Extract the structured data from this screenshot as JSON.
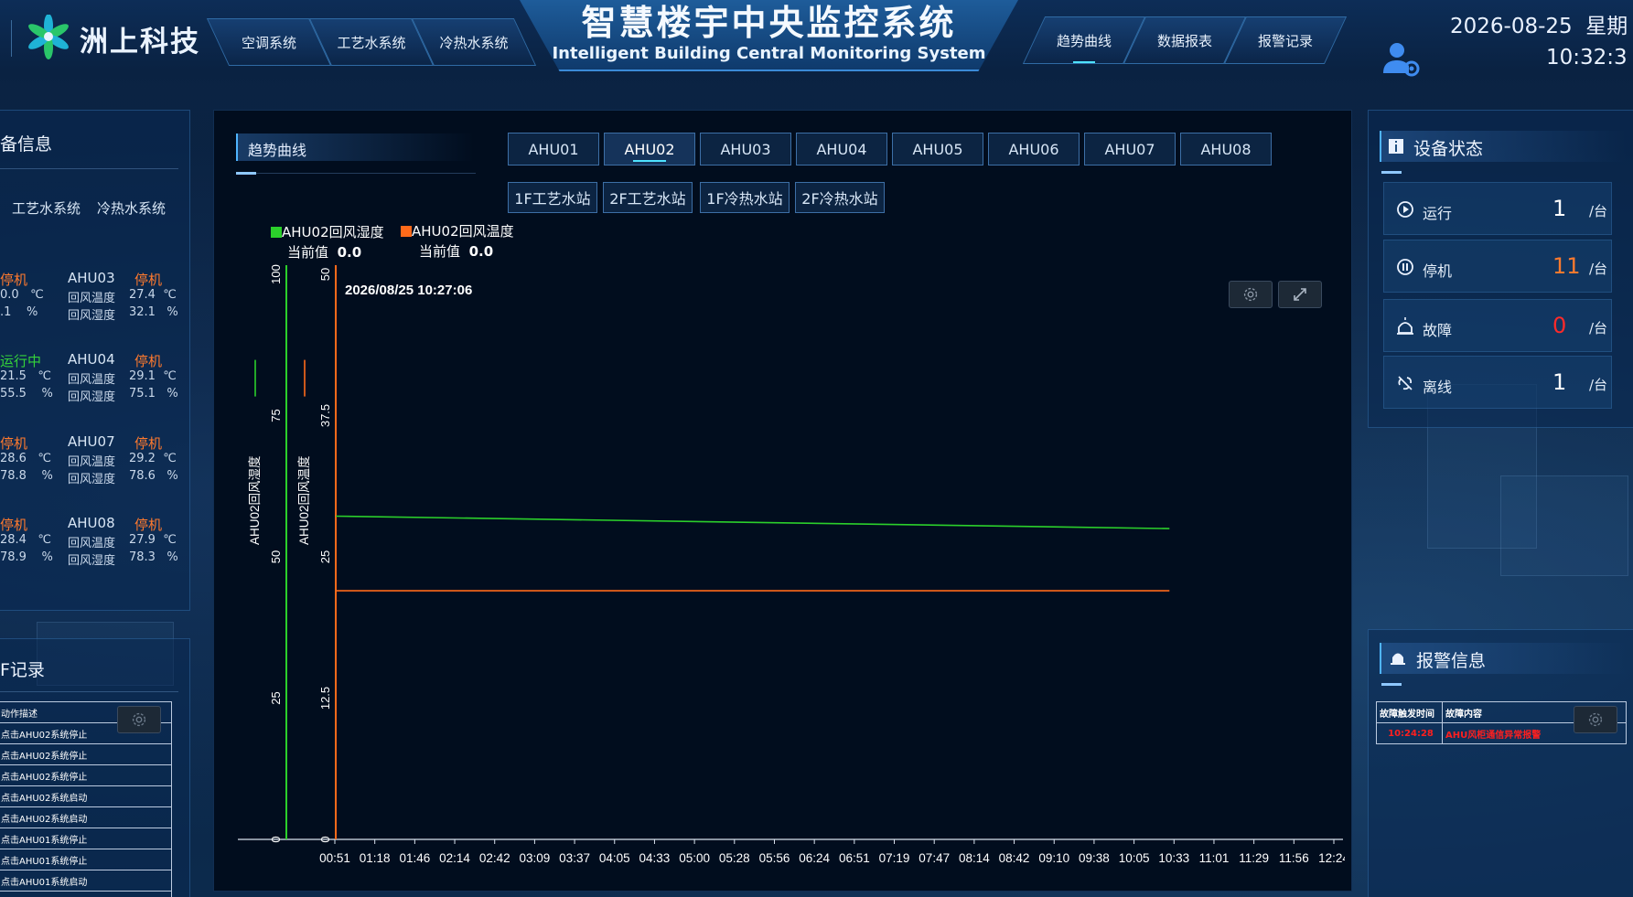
{
  "header": {
    "logo_text": "洲上科技",
    "title_cn": "智慧楼宇中央监控系统",
    "title_en": "Intelligent Building Central Monitoring System",
    "nav_left": [
      "空调系统",
      "工艺水系统",
      "冷热水系统"
    ],
    "nav_right": [
      "趋势曲线",
      "数据报表",
      "报警记录"
    ],
    "active_nav": "趋势曲线",
    "date": "2026-08-25",
    "weekday": "星期",
    "time": "10:32:3"
  },
  "left_panel": {
    "title": "备信息",
    "tabs": [
      "工艺水系统",
      "冷热水系统"
    ],
    "units": [
      {
        "left_status": "停机",
        "left_temp": "0.0",
        "left_hum": ".1",
        "name": "AHU03",
        "status": "停机",
        "temp": "27.4",
        "hum": "32.1"
      },
      {
        "left_status": "运行中",
        "left_temp": "21.5",
        "left_hum": "55.5",
        "name": "AHU04",
        "status": "停机",
        "temp": "29.1",
        "hum": "75.1"
      },
      {
        "left_status": "停机",
        "left_temp": "28.6",
        "left_hum": "78.8",
        "name": "AHU07",
        "status": "停机",
        "temp": "29.2",
        "hum": "78.6"
      },
      {
        "left_status": "停机",
        "left_temp": "28.4",
        "left_hum": "78.9",
        "name": "AHU08",
        "status": "停机",
        "temp": "27.9",
        "hum": "78.3"
      }
    ],
    "temp_label": "回风温度",
    "hum_label": "回风湿度",
    "temp_unit": "℃",
    "hum_unit": "%"
  },
  "log_panel": {
    "title": "F记录",
    "header": "动作描述",
    "rows": [
      "点击AHU02系统停止",
      "点击AHU02系统停止",
      "点击AHU02系统停止",
      "点击AHU02系统启动",
      "点击AHU02系统启动",
      "点击AHU01系统停止",
      "点击AHU01系统停止",
      "点击AHU01系统启动",
      "点击AHU01系统启动"
    ]
  },
  "main": {
    "section_title": "趋势曲线",
    "ahu_tabs": [
      "AHU01",
      "AHU02",
      "AHU03",
      "AHU04",
      "AHU05",
      "AHU06",
      "AHU07",
      "AHU08"
    ],
    "active_ahu": "AHU02",
    "station_tabs": [
      "1F工艺水站",
      "2F工艺水站",
      "1F冷热水站",
      "2F冷热水站"
    ],
    "legend": [
      {
        "name": "AHU02回风湿度",
        "color": "#2bcf2b",
        "current_label": "当前值",
        "current_value": "0.0"
      },
      {
        "name": "AHU02回风温度",
        "color": "#ff6a1a",
        "current_label": "当前值",
        "current_value": "0.0"
      }
    ],
    "timestamp": "2026/08/25 10:27:06",
    "settings_icon": "gear-icon",
    "expand_icon": "expand-icon"
  },
  "chart_data": {
    "type": "line",
    "x": [
      "00:51",
      "01:18",
      "01:46",
      "02:14",
      "02:42",
      "03:09",
      "03:37",
      "04:05",
      "04:33",
      "05:00",
      "05:28",
      "05:56",
      "06:24",
      "06:51",
      "07:19",
      "07:47",
      "08:14",
      "08:42",
      "09:10",
      "09:38",
      "10:05",
      "10:33",
      "11:01",
      "11:29",
      "11:56",
      "12:24"
    ],
    "x_end": "10:33",
    "series": [
      {
        "name": "AHU02回风湿度",
        "color": "#2bcf2b",
        "axis": "left",
        "start": 57.2,
        "end": 55.0
      },
      {
        "name": "AHU02回风温度",
        "color": "#ff6a1a",
        "axis": "right",
        "start": 22.0,
        "end": 22.0
      }
    ],
    "y_left": {
      "label": "AHU02回风湿度",
      "ticks": [
        "0",
        "25",
        "50",
        "75",
        "100"
      ],
      "range": [
        0,
        100
      ]
    },
    "y_right": {
      "label": "AHU02回风温度",
      "ticks": [
        "0",
        "12.5",
        "25",
        "37.5",
        "50"
      ],
      "range": [
        0,
        50
      ]
    }
  },
  "right_panel": {
    "title": "设备状态",
    "stats": [
      {
        "label": "运行",
        "value": "1",
        "unit": "/台",
        "color": "#ffffff",
        "icon": "play-icon"
      },
      {
        "label": "停机",
        "value": "11",
        "unit": "/台",
        "color": "#ff7a2e",
        "icon": "pause-icon"
      },
      {
        "label": "故障",
        "value": "0",
        "unit": "/台",
        "color": "#ff2a2a",
        "icon": "alarm-icon"
      },
      {
        "label": "离线",
        "value": "1",
        "unit": "/台",
        "color": "#ffffff",
        "icon": "offline-icon"
      }
    ]
  },
  "alarm_panel": {
    "title": "报警信息",
    "header_time": "故障触发时间",
    "header_content": "故障内容",
    "rows": [
      {
        "time": "10:24:28",
        "content": "AHU风柜通信异常报警"
      }
    ]
  }
}
